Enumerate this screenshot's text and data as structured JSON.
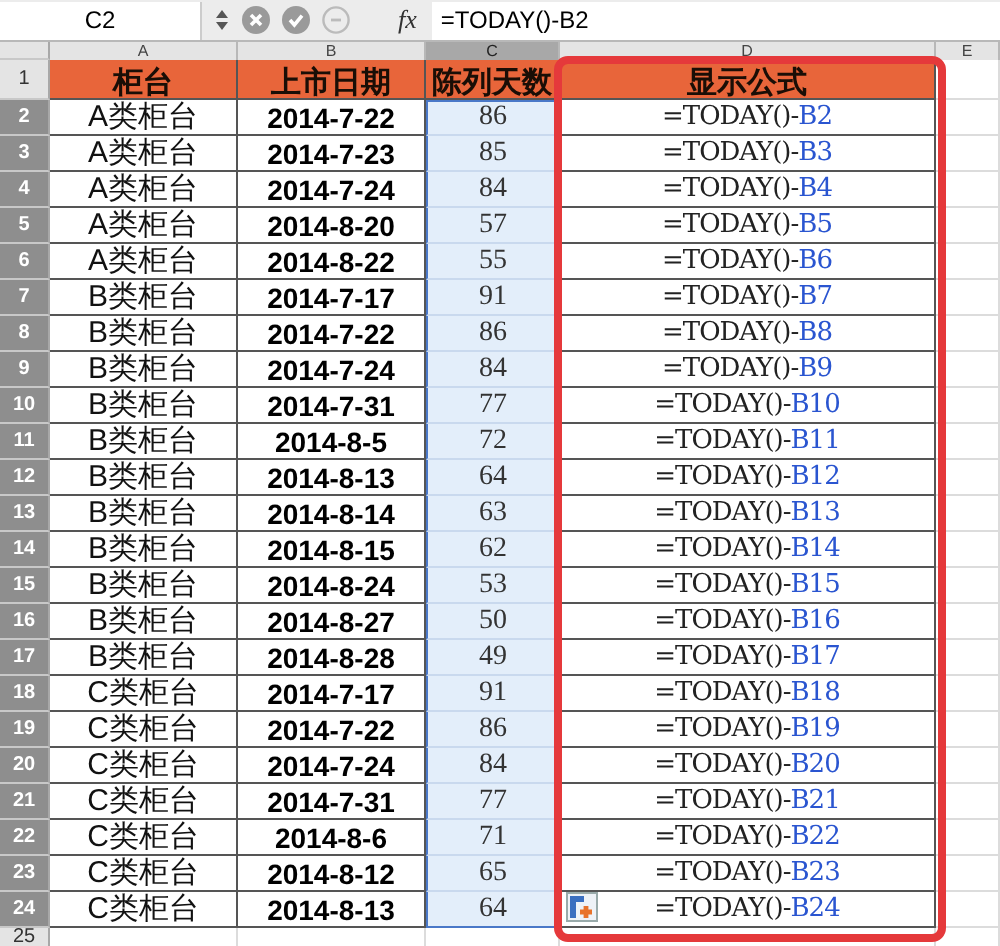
{
  "formula_bar": {
    "name_box": "C2",
    "fx": "fx",
    "formula": "=TODAY()-B2"
  },
  "columns": [
    {
      "label": "A",
      "selected": false
    },
    {
      "label": "B",
      "selected": false
    },
    {
      "label": "C",
      "selected": true
    },
    {
      "label": "D",
      "selected": false
    },
    {
      "label": "E",
      "selected": false
    }
  ],
  "header_row": {
    "row": "1",
    "selected": false,
    "cells": [
      "柜台",
      "上市日期",
      "陈列天数",
      "显示公式"
    ]
  },
  "rows": [
    {
      "row": "2",
      "selected": true,
      "counter": "A类柜台",
      "date": "2014-7-22",
      "days": "86",
      "formula": "=TODAY()-",
      "ref": "B2"
    },
    {
      "row": "3",
      "selected": true,
      "counter": "A类柜台",
      "date": "2014-7-23",
      "days": "85",
      "formula": "=TODAY()-",
      "ref": "B3"
    },
    {
      "row": "4",
      "selected": true,
      "counter": "A类柜台",
      "date": "2014-7-24",
      "days": "84",
      "formula": "=TODAY()-",
      "ref": "B4"
    },
    {
      "row": "5",
      "selected": true,
      "counter": "A类柜台",
      "date": "2014-8-20",
      "days": "57",
      "formula": "=TODAY()-",
      "ref": "B5"
    },
    {
      "row": "6",
      "selected": true,
      "counter": "A类柜台",
      "date": "2014-8-22",
      "days": "55",
      "formula": "=TODAY()-",
      "ref": "B6"
    },
    {
      "row": "7",
      "selected": true,
      "counter": "B类柜台",
      "date": "2014-7-17",
      "days": "91",
      "formula": "=TODAY()-",
      "ref": "B7"
    },
    {
      "row": "8",
      "selected": true,
      "counter": "B类柜台",
      "date": "2014-7-22",
      "days": "86",
      "formula": "=TODAY()-",
      "ref": "B8"
    },
    {
      "row": "9",
      "selected": true,
      "counter": "B类柜台",
      "date": "2014-7-24",
      "days": "84",
      "formula": "=TODAY()-",
      "ref": "B9"
    },
    {
      "row": "10",
      "selected": true,
      "counter": "B类柜台",
      "date": "2014-7-31",
      "days": "77",
      "formula": "=TODAY()-",
      "ref": "B10"
    },
    {
      "row": "11",
      "selected": true,
      "counter": "B类柜台",
      "date": "2014-8-5",
      "days": "72",
      "formula": "=TODAY()-",
      "ref": "B11"
    },
    {
      "row": "12",
      "selected": true,
      "counter": "B类柜台",
      "date": "2014-8-13",
      "days": "64",
      "formula": "=TODAY()-",
      "ref": "B12"
    },
    {
      "row": "13",
      "selected": true,
      "counter": "B类柜台",
      "date": "2014-8-14",
      "days": "63",
      "formula": "=TODAY()-",
      "ref": "B13"
    },
    {
      "row": "14",
      "selected": true,
      "counter": "B类柜台",
      "date": "2014-8-15",
      "days": "62",
      "formula": "=TODAY()-",
      "ref": "B14"
    },
    {
      "row": "15",
      "selected": true,
      "counter": "B类柜台",
      "date": "2014-8-24",
      "days": "53",
      "formula": "=TODAY()-",
      "ref": "B15"
    },
    {
      "row": "16",
      "selected": true,
      "counter": "B类柜台",
      "date": "2014-8-27",
      "days": "50",
      "formula": "=TODAY()-",
      "ref": "B16"
    },
    {
      "row": "17",
      "selected": true,
      "counter": "B类柜台",
      "date": "2014-8-28",
      "days": "49",
      "formula": "=TODAY()-",
      "ref": "B17"
    },
    {
      "row": "18",
      "selected": true,
      "counter": "C类柜台",
      "date": "2014-7-17",
      "days": "91",
      "formula": "=TODAY()-",
      "ref": "B18"
    },
    {
      "row": "19",
      "selected": true,
      "counter": "C类柜台",
      "date": "2014-7-22",
      "days": "86",
      "formula": "=TODAY()-",
      "ref": "B19"
    },
    {
      "row": "20",
      "selected": true,
      "counter": "C类柜台",
      "date": "2014-7-24",
      "days": "84",
      "formula": "=TODAY()-",
      "ref": "B20"
    },
    {
      "row": "21",
      "selected": true,
      "counter": "C类柜台",
      "date": "2014-7-31",
      "days": "77",
      "formula": "=TODAY()-",
      "ref": "B21"
    },
    {
      "row": "22",
      "selected": true,
      "counter": "C类柜台",
      "date": "2014-8-6",
      "days": "71",
      "formula": "=TODAY()-",
      "ref": "B22"
    },
    {
      "row": "23",
      "selected": true,
      "counter": "C类柜台",
      "date": "2014-8-12",
      "days": "65",
      "formula": "=TODAY()-",
      "ref": "B23"
    },
    {
      "row": "24",
      "selected": true,
      "counter": "C类柜台",
      "date": "2014-8-13",
      "days": "64",
      "formula": "=TODAY()-",
      "ref": "B24"
    }
  ],
  "trailing_row": {
    "row": "25",
    "selected": false
  },
  "highlight_frame": true,
  "paste_options": true
}
